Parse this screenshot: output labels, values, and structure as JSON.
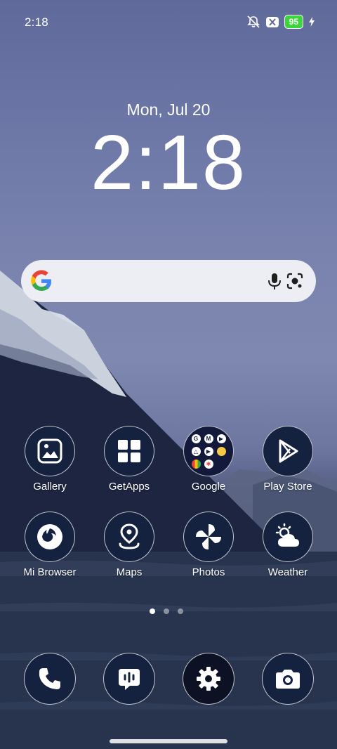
{
  "status_bar": {
    "time": "2:18",
    "battery": "95",
    "icons": [
      "mute-icon",
      "no-sim-icon",
      "charging-icon"
    ]
  },
  "clock_widget": {
    "date": "Mon, Jul 20",
    "time": "2:18"
  },
  "search_bar": {
    "icons": [
      "google-logo-icon",
      "mic-icon",
      "lens-icon"
    ]
  },
  "apps": [
    {
      "label": "Gallery",
      "icon": "gallery-icon"
    },
    {
      "label": "GetApps",
      "icon": "getapps-icon"
    },
    {
      "label": "Google",
      "icon": "folder-icon"
    },
    {
      "label": "Play Store",
      "icon": "play-store-icon"
    },
    {
      "label": "Mi Browser",
      "icon": "browser-icon"
    },
    {
      "label": "Maps",
      "icon": "maps-icon"
    },
    {
      "label": "Photos",
      "icon": "photos-icon"
    },
    {
      "label": "Weather",
      "icon": "weather-icon"
    }
  ],
  "folder_mini_labels": [
    "G",
    "M",
    "▶",
    "△",
    "▶",
    "",
    "",
    "✱"
  ],
  "dock": [
    {
      "icon": "phone-icon"
    },
    {
      "icon": "messages-icon"
    },
    {
      "icon": "settings-icon"
    },
    {
      "icon": "camera-icon"
    }
  ],
  "page_indicator": {
    "pages": 3,
    "current": 1
  },
  "colors": {
    "icon_bg": "#14213f",
    "battery": "#3fd33f",
    "search_bg": "#eceef4"
  }
}
